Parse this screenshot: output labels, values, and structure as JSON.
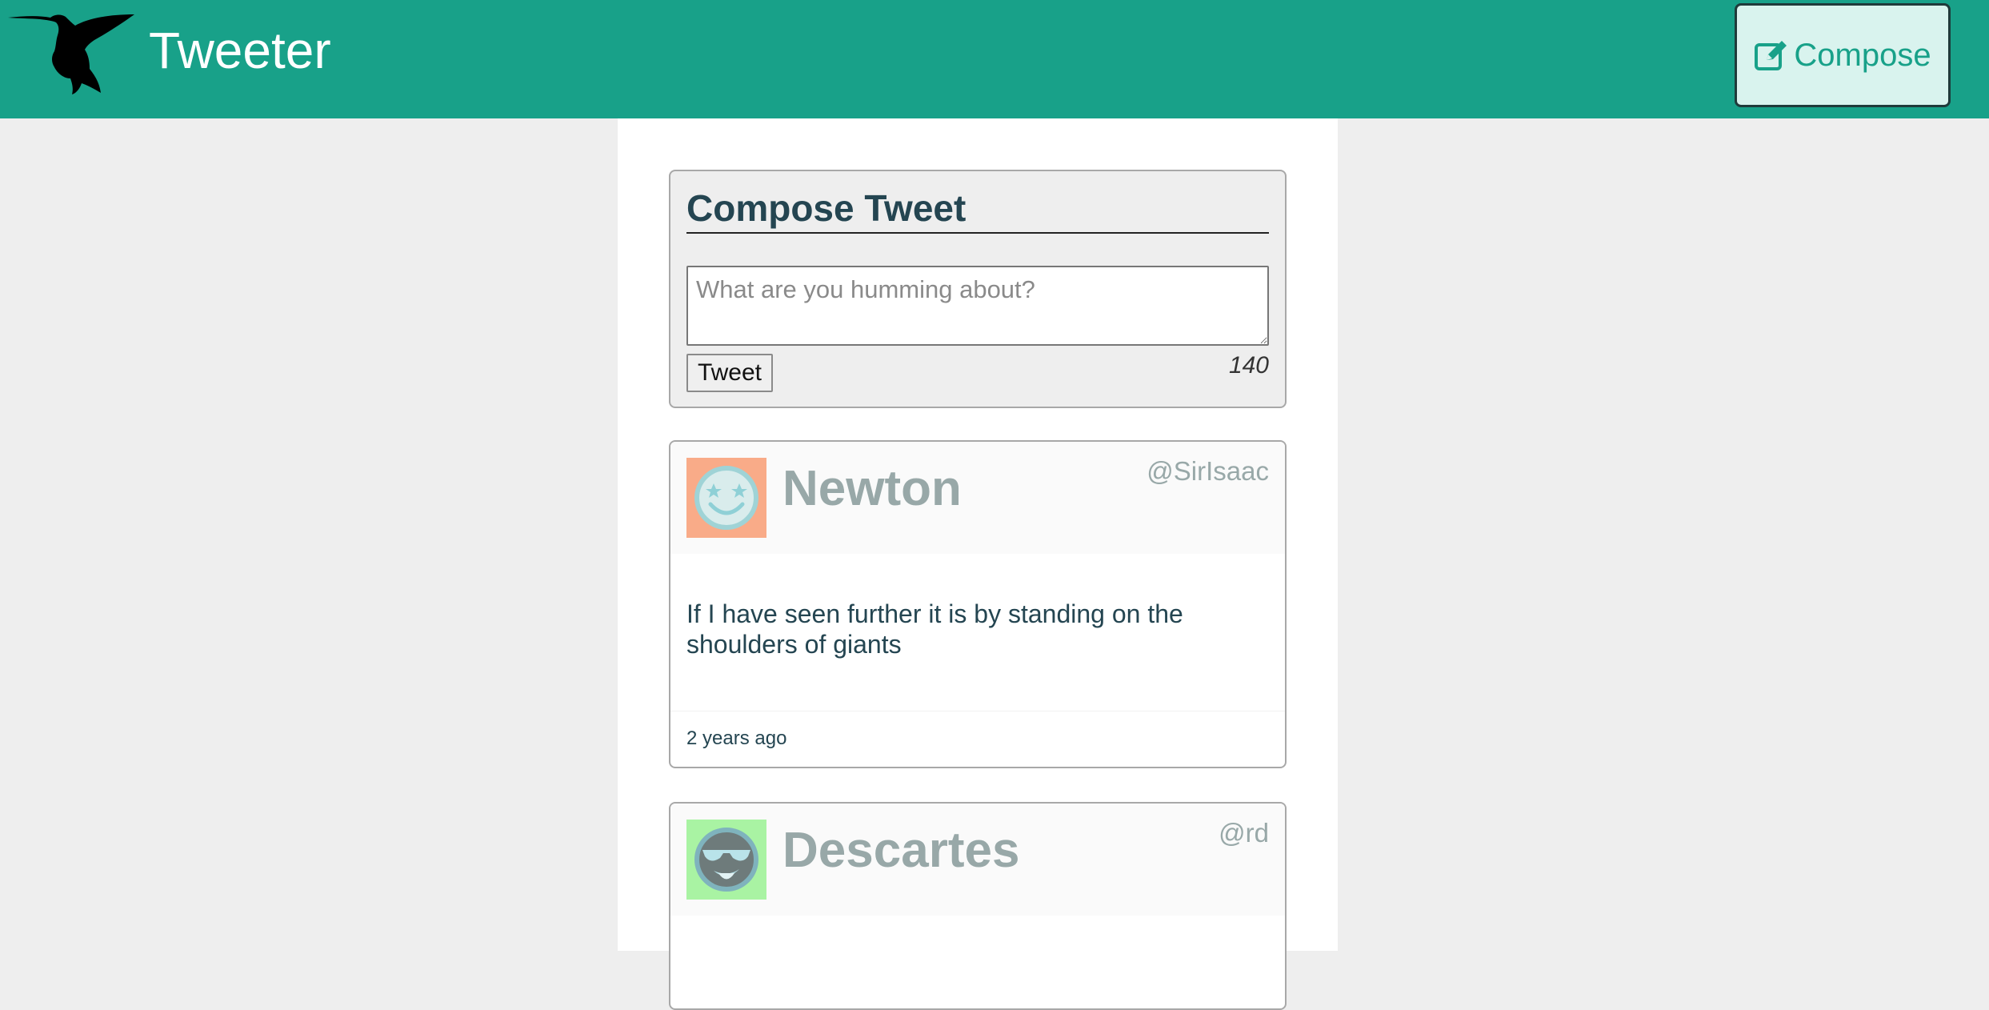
{
  "header": {
    "brand": "Tweeter",
    "compose_label": "Compose",
    "logo_icon": "hummingbird-icon",
    "compose_icon": "edit-icon",
    "background_color": "#18a189"
  },
  "compose": {
    "title": "Compose Tweet",
    "placeholder": "What are you humming about?",
    "submit_label": "Tweet",
    "counter": "140"
  },
  "tweets": [
    {
      "name": "Newton",
      "handle": "@SirIsaac",
      "text": "If I have seen further it is by standing on the shoulders of giants",
      "timestamp": "2 years ago",
      "avatar_icon": "star-eyes-smiley-avatar",
      "avatar_bg": "#f9ab88"
    },
    {
      "name": "Descartes",
      "handle": "@rd",
      "avatar_icon": "sunglasses-smiley-avatar",
      "avatar_bg": "#a9f3a3"
    }
  ]
}
